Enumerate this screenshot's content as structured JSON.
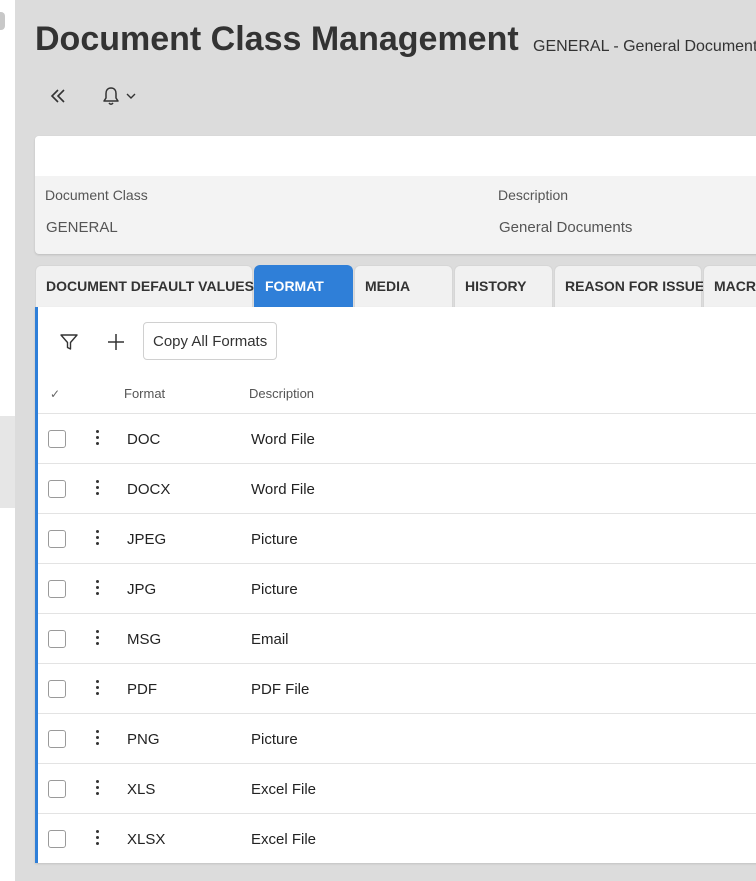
{
  "page": {
    "title": "Document Class Management",
    "subtitle": "GENERAL - General Documents"
  },
  "toolbar": {
    "collapse_icon": "double-chevron-left-icon",
    "bell_icon": "bell-icon",
    "dropdown_icon": "chevron-down-icon"
  },
  "header": {
    "document_class_label": "Document Class",
    "document_class_value": "GENERAL",
    "description_label": "Description",
    "description_value": "General Documents"
  },
  "tabs": [
    {
      "label": "DOCUMENT DEFAULT VALUES",
      "active": false
    },
    {
      "label": "FORMAT",
      "active": true
    },
    {
      "label": "MEDIA",
      "active": false
    },
    {
      "label": "HISTORY",
      "active": false
    },
    {
      "label": "REASON FOR ISSUE",
      "active": false
    },
    {
      "label": "MACRO",
      "active": false
    }
  ],
  "format_panel": {
    "filter_icon": "filter-icon",
    "add_icon": "plus-icon",
    "copy_all_label": "Copy All Formats",
    "select_all_mark": "✓",
    "columns": {
      "format": "Format",
      "description": "Description"
    },
    "rows": [
      {
        "format": "DOC",
        "description": "Word File"
      },
      {
        "format": "DOCX",
        "description": "Word File"
      },
      {
        "format": "JPEG",
        "description": "Picture"
      },
      {
        "format": "JPG",
        "description": "Picture"
      },
      {
        "format": "MSG",
        "description": "Email"
      },
      {
        "format": "PDF",
        "description": "PDF File"
      },
      {
        "format": "PNG",
        "description": "Picture"
      },
      {
        "format": "XLS",
        "description": "Excel File"
      },
      {
        "format": "XLSX",
        "description": "Excel File"
      }
    ]
  },
  "colors": {
    "accent": "#2f7fd8",
    "background": "#dcdcdc",
    "panel": "#ffffff"
  }
}
